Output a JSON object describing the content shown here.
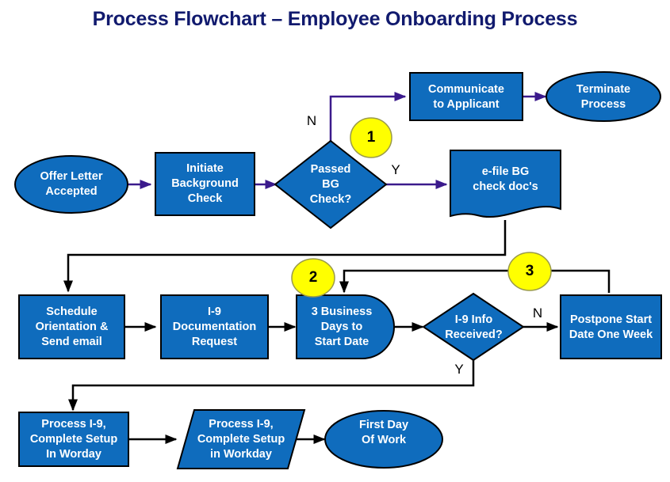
{
  "title": "Process Flowchart – Employee Onboarding Process",
  "colors": {
    "title_text": "#111a6e",
    "node_fill": "#0f6cbd",
    "node_stroke": "#000000",
    "node_text": "#ffffff",
    "marker_fill": "#ffff00",
    "marker_stroke": "#9a9a4a",
    "marker_text": "#000000",
    "purple_connector": "#3b1a8c",
    "black_connector": "#000000",
    "background": "#ffffff"
  },
  "nodes": {
    "offer_letter": {
      "label": "Offer Letter\nAccepted",
      "shape": "ellipse"
    },
    "initiate_bg": {
      "label": "Initiate\nBackground\nCheck",
      "shape": "process"
    },
    "passed_bg": {
      "label": "Passed\nBG\nCheck?",
      "shape": "decision"
    },
    "communicate": {
      "label": "Communicate\nto Applicant",
      "shape": "process"
    },
    "terminate": {
      "label": "Terminate\nProcess",
      "shape": "ellipse"
    },
    "efile": {
      "label": "e-file BG\ncheck doc's",
      "shape": "document"
    },
    "schedule": {
      "label": "Schedule\nOrientation &\nSend email",
      "shape": "process"
    },
    "i9_doc_request": {
      "label": "I-9\nDocumentation\nRequest",
      "shape": "process"
    },
    "three_days": {
      "label": "3 Business\nDays to\nStart Date",
      "shape": "delay"
    },
    "i9_received": {
      "label": "I-9 Info\nReceived?",
      "shape": "decision"
    },
    "postpone": {
      "label": "Postpone Start\nDate One Week",
      "shape": "process"
    },
    "process_i9_worday": {
      "label": "Process I-9,\nComplete Setup\nIn Worday",
      "shape": "process"
    },
    "process_i9_workday": {
      "label": "Process I-9,\nComplete Setup\nin Workday",
      "shape": "parallelogram"
    },
    "first_day": {
      "label": "First Day\nOf Work",
      "shape": "ellipse"
    }
  },
  "markers": [
    {
      "id": "marker-1",
      "label": "1"
    },
    {
      "id": "marker-2",
      "label": "2"
    },
    {
      "id": "marker-3",
      "label": "3"
    }
  ],
  "edge_labels": {
    "bg_no": "N",
    "bg_yes": "Y",
    "i9_no": "N",
    "i9_yes": "Y"
  }
}
